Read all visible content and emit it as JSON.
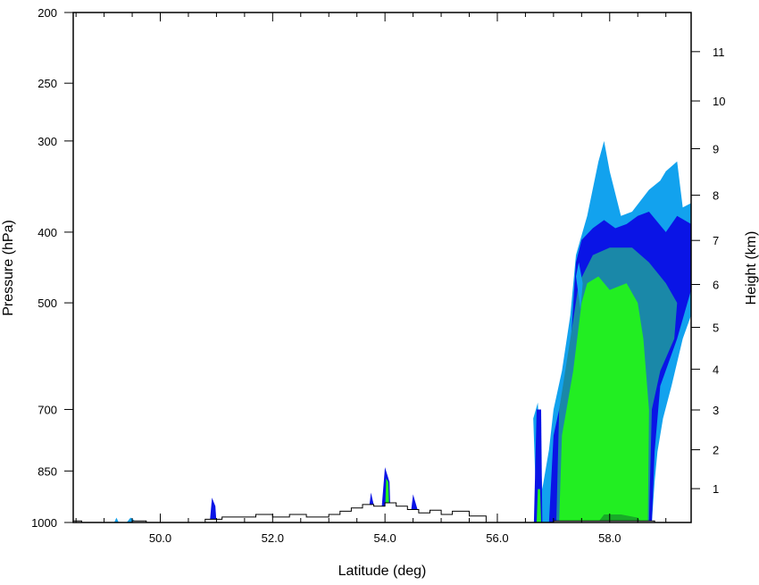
{
  "chart_data": {
    "type": "heatmap",
    "title": "",
    "xlabel": "Latitude (deg)",
    "ylabel": "Pressure (hPa)",
    "y2label": "Height (km)",
    "xlim": [
      48.45,
      59.45
    ],
    "ylim": [
      1000,
      200
    ],
    "yscale": "log",
    "x_ticks": [
      "50.0",
      "52.0",
      "54.0",
      "56.0",
      "58.0"
    ],
    "x_tick_values": [
      50,
      52,
      54,
      56,
      58
    ],
    "y_ticks": [
      "200",
      "250",
      "300",
      "400",
      "500",
      "700",
      "850",
      "1000"
    ],
    "y_tick_values": [
      200,
      250,
      300,
      400,
      500,
      700,
      850,
      1000
    ],
    "y2_ticks": [
      "1",
      "2",
      "3",
      "4",
      "5",
      "6",
      "7",
      "8",
      "9",
      "10",
      "11"
    ],
    "y2_tick_values_pressure": [
      898.7,
      794.9,
      701.1,
      616.4,
      540.2,
      471.8,
      410.6,
      356.0,
      307.4,
      264.4,
      226.3
    ],
    "grid": false,
    "legend": "none",
    "colors": {
      "level1": "#12a2ee",
      "level2": "#1e7ab4",
      "level3": "#0a14e6",
      "level4": "#1a88a8",
      "level5": "#22ee22",
      "level6": "#18aa28",
      "terrain": "#ffffff",
      "terrain_outline": "#000000"
    },
    "regions": [
      {
        "name": "outer",
        "level": 1,
        "points": [
          [
            56.7,
            990
          ],
          [
            56.64,
            720
          ],
          [
            56.72,
            685
          ],
          [
            56.8,
            900
          ],
          [
            56.92,
            795
          ],
          [
            57.0,
            700
          ],
          [
            57.15,
            620
          ],
          [
            57.3,
            520
          ],
          [
            57.4,
            430
          ],
          [
            57.6,
            380
          ],
          [
            57.8,
            320
          ],
          [
            57.9,
            300
          ],
          [
            58.0,
            330
          ],
          [
            58.2,
            380
          ],
          [
            58.4,
            375
          ],
          [
            58.7,
            350
          ],
          [
            58.9,
            340
          ],
          [
            59.0,
            330
          ],
          [
            59.2,
            320
          ],
          [
            59.3,
            370
          ],
          [
            59.45,
            365
          ],
          [
            59.45,
            520
          ],
          [
            59.3,
            560
          ],
          [
            59.1,
            650
          ],
          [
            58.95,
            720
          ],
          [
            58.85,
            800
          ],
          [
            58.8,
            880
          ],
          [
            58.75,
            1000
          ],
          [
            56.7,
            1000
          ]
        ]
      },
      {
        "name": "inner-blue",
        "level": 3,
        "points": [
          [
            56.92,
            1000
          ],
          [
            57.0,
            760
          ],
          [
            57.1,
            700
          ],
          [
            57.3,
            580
          ],
          [
            57.4,
            440
          ],
          [
            57.5,
            410
          ],
          [
            57.7,
            395
          ],
          [
            57.9,
            385
          ],
          [
            58.1,
            395
          ],
          [
            58.3,
            390
          ],
          [
            58.5,
            380
          ],
          [
            58.7,
            375
          ],
          [
            59.0,
            400
          ],
          [
            59.2,
            380
          ],
          [
            59.45,
            390
          ],
          [
            59.45,
            480
          ],
          [
            59.2,
            560
          ],
          [
            58.9,
            650
          ],
          [
            58.8,
            800
          ],
          [
            58.75,
            1000
          ]
        ]
      },
      {
        "name": "teal",
        "level": 4,
        "points": [
          [
            57.05,
            1000
          ],
          [
            57.1,
            700
          ],
          [
            57.3,
            560
          ],
          [
            57.45,
            470
          ],
          [
            57.7,
            430
          ],
          [
            58.0,
            420
          ],
          [
            58.4,
            420
          ],
          [
            58.7,
            440
          ],
          [
            59.0,
            470
          ],
          [
            59.2,
            500
          ],
          [
            59.15,
            560
          ],
          [
            58.9,
            620
          ],
          [
            58.75,
            700
          ],
          [
            58.7,
            1000
          ]
        ]
      },
      {
        "name": "green",
        "level": 5,
        "points": [
          [
            57.1,
            995
          ],
          [
            57.15,
            760
          ],
          [
            57.35,
            620
          ],
          [
            57.5,
            500
          ],
          [
            57.6,
            470
          ],
          [
            57.8,
            460
          ],
          [
            58.0,
            480
          ],
          [
            58.3,
            470
          ],
          [
            58.5,
            500
          ],
          [
            58.6,
            560
          ],
          [
            58.7,
            700
          ],
          [
            58.68,
            995
          ]
        ]
      },
      {
        "name": "dark-green",
        "level": 6,
        "points": [
          [
            57.8,
            998
          ],
          [
            57.9,
            975
          ],
          [
            58.2,
            975
          ],
          [
            58.5,
            985
          ],
          [
            58.55,
            998
          ]
        ]
      },
      {
        "name": "spike-a",
        "level": 3,
        "points": [
          [
            56.65,
            1000
          ],
          [
            56.7,
            700
          ],
          [
            56.78,
            700
          ],
          [
            56.8,
            1000
          ]
        ]
      },
      {
        "name": "spike-a-core",
        "level": 5,
        "points": [
          [
            56.7,
            1000
          ],
          [
            56.72,
            900
          ],
          [
            56.76,
            900
          ],
          [
            56.78,
            1000
          ]
        ]
      },
      {
        "name": "blob-c1",
        "level": 3,
        "points": [
          [
            53.7,
            980
          ],
          [
            53.75,
            910
          ],
          [
            53.82,
            960
          ],
          [
            53.85,
            990
          ]
        ]
      },
      {
        "name": "blob-c2",
        "level": 3,
        "points": [
          [
            53.93,
            980
          ],
          [
            54.0,
            840
          ],
          [
            54.08,
            880
          ],
          [
            54.1,
            985
          ]
        ]
      },
      {
        "name": "blob-c2-core",
        "level": 5,
        "points": [
          [
            54.0,
            990
          ],
          [
            54.02,
            870
          ],
          [
            54.06,
            880
          ],
          [
            54.08,
            990
          ]
        ]
      },
      {
        "name": "blob-c3",
        "level": 3,
        "points": [
          [
            54.45,
            985
          ],
          [
            54.5,
            915
          ],
          [
            54.58,
            960
          ],
          [
            54.6,
            990
          ]
        ]
      },
      {
        "name": "blob-w1",
        "level": 3,
        "points": [
          [
            50.88,
            1000
          ],
          [
            50.92,
            925
          ],
          [
            50.98,
            950
          ],
          [
            51.0,
            1000
          ]
        ]
      },
      {
        "name": "blob-w2",
        "level": 1,
        "points": [
          [
            49.4,
            1000
          ],
          [
            49.47,
            985
          ],
          [
            49.55,
            995
          ],
          [
            49.58,
            1000
          ]
        ]
      },
      {
        "name": "blob-w3",
        "level": 1,
        "points": [
          [
            49.18,
            1000
          ],
          [
            49.22,
            985
          ],
          [
            49.26,
            1000
          ]
        ]
      },
      {
        "name": "blob-isolated",
        "level": 1,
        "points": [
          [
            57.4,
            460
          ],
          [
            57.45,
            440
          ],
          [
            57.52,
            470
          ],
          [
            57.48,
            510
          ]
        ]
      }
    ],
    "terrain_steps": [
      [
        48.45,
        995
      ],
      [
        48.6,
        995
      ],
      [
        48.6,
        1000
      ],
      [
        49.5,
        1000
      ],
      [
        49.5,
        995
      ],
      [
        49.75,
        995
      ],
      [
        49.75,
        1000
      ],
      [
        50.8,
        1000
      ],
      [
        50.8,
        990
      ],
      [
        51.1,
        990
      ],
      [
        51.1,
        983
      ],
      [
        51.7,
        983
      ],
      [
        51.7,
        975
      ],
      [
        52.0,
        975
      ],
      [
        52.0,
        983
      ],
      [
        52.3,
        983
      ],
      [
        52.3,
        975
      ],
      [
        52.6,
        975
      ],
      [
        52.6,
        983
      ],
      [
        53.0,
        983
      ],
      [
        53.0,
        975
      ],
      [
        53.2,
        975
      ],
      [
        53.2,
        965
      ],
      [
        53.4,
        965
      ],
      [
        53.4,
        955
      ],
      [
        53.6,
        955
      ],
      [
        53.6,
        945
      ],
      [
        53.8,
        945
      ],
      [
        53.8,
        950
      ],
      [
        54.0,
        950
      ],
      [
        54.0,
        940
      ],
      [
        54.2,
        940
      ],
      [
        54.2,
        950
      ],
      [
        54.4,
        950
      ],
      [
        54.4,
        960
      ],
      [
        54.6,
        960
      ],
      [
        54.6,
        970
      ],
      [
        54.8,
        970
      ],
      [
        54.8,
        962
      ],
      [
        55.0,
        962
      ],
      [
        55.0,
        975
      ],
      [
        55.2,
        975
      ],
      [
        55.2,
        965
      ],
      [
        55.5,
        965
      ],
      [
        55.5,
        980
      ],
      [
        55.8,
        980
      ],
      [
        55.8,
        1000
      ],
      [
        56.4,
        1000
      ],
      [
        56.4,
        1000
      ],
      [
        57.0,
        1000
      ],
      [
        57.0,
        995
      ],
      [
        58.8,
        995
      ],
      [
        58.8,
        1000
      ],
      [
        59.45,
        1000
      ]
    ]
  }
}
